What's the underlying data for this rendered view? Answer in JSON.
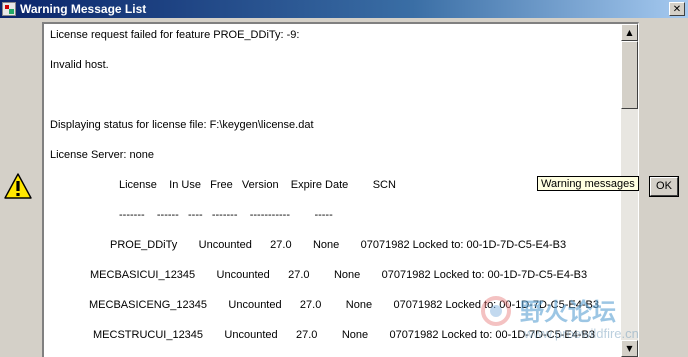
{
  "window": {
    "title": "Warning Message List",
    "close_glyph": "✕"
  },
  "message_lines": [
    "License request failed for feature PROE_DDiTy: -9:",
    "Invalid host.",
    "Displaying status for license file: F:\\keygen\\license.dat",
    "License Server: none",
    "License    In Use   Free   Version    Expire Date        SCN",
    "-------    ------   ----   -------    -----------        -----",
    "PROE_DDiTy       Uncounted      27.0       None       07071982 Locked to: 00-1D-7D-C5-E4-B3",
    "MECBASICUI_12345       Uncounted      27.0        None       07071982 Locked to: 00-1D-7D-C5-E4-B3",
    "MECBASICENG_12345       Uncounted      27.0        None       07071982 Locked to: 00-1D-7D-C5-E4-B3",
    "MECSTRUCUI_12345       Uncounted      27.0        None       07071982 Locked to: 00-1D-7D-C5-E4-B3"
  ],
  "tooltip": {
    "text": "Warning messages"
  },
  "buttons": {
    "ok_label": "OK"
  },
  "scrollbar": {
    "up_glyph": "▲",
    "down_glyph": "▼"
  },
  "icons": {
    "warning": "warning-icon",
    "app": "app-icon",
    "close": "close-icon"
  },
  "watermark": {
    "text": "野火论坛",
    "url": "www.proewildfire.cn"
  },
  "colors": {
    "titlebar_start": "#0a246a",
    "titlebar_end": "#a6caf0",
    "warning_fill": "#ffe600",
    "dialog_bg": "#d4d0c8",
    "tooltip_bg": "#ffffe1"
  }
}
